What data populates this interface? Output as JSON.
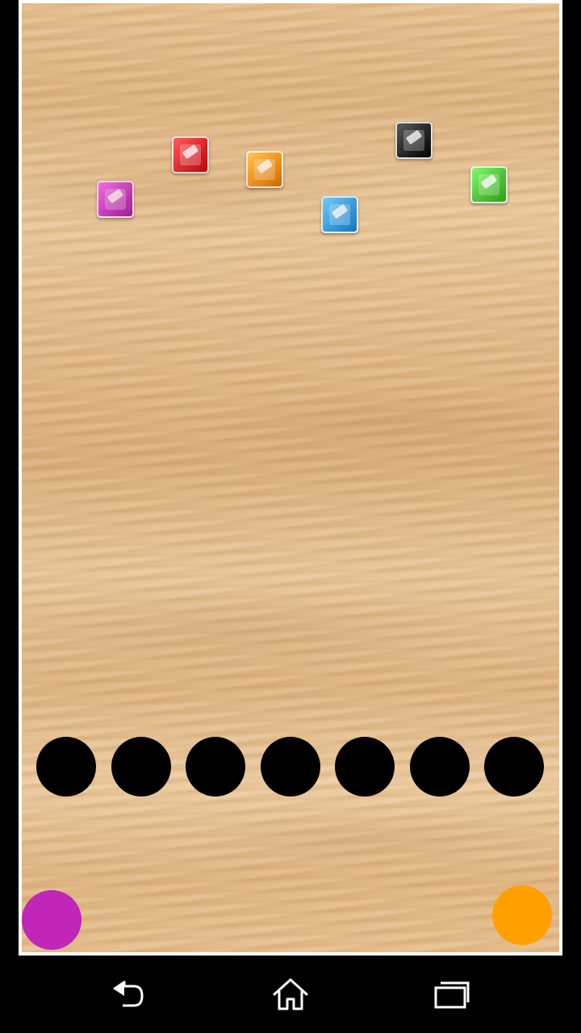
{
  "gems": [
    {
      "name": "magenta-gem",
      "color": "#c93bc8"
    },
    {
      "name": "red-gem",
      "color": "#e02a2f"
    },
    {
      "name": "orange-gem",
      "color": "#f5961e"
    },
    {
      "name": "blue-gem",
      "color": "#3d9fe0"
    },
    {
      "name": "black-gem",
      "color": "#2a2a2a"
    },
    {
      "name": "green-gem",
      "color": "#52c83a"
    }
  ],
  "slots": {
    "count": 7,
    "color": "#000000"
  },
  "buttons": {
    "left_color": "#c026b8",
    "right_color": "#ffa000"
  },
  "navbar": {
    "icons": [
      "back-icon",
      "home-icon",
      "recent-apps-icon"
    ]
  }
}
